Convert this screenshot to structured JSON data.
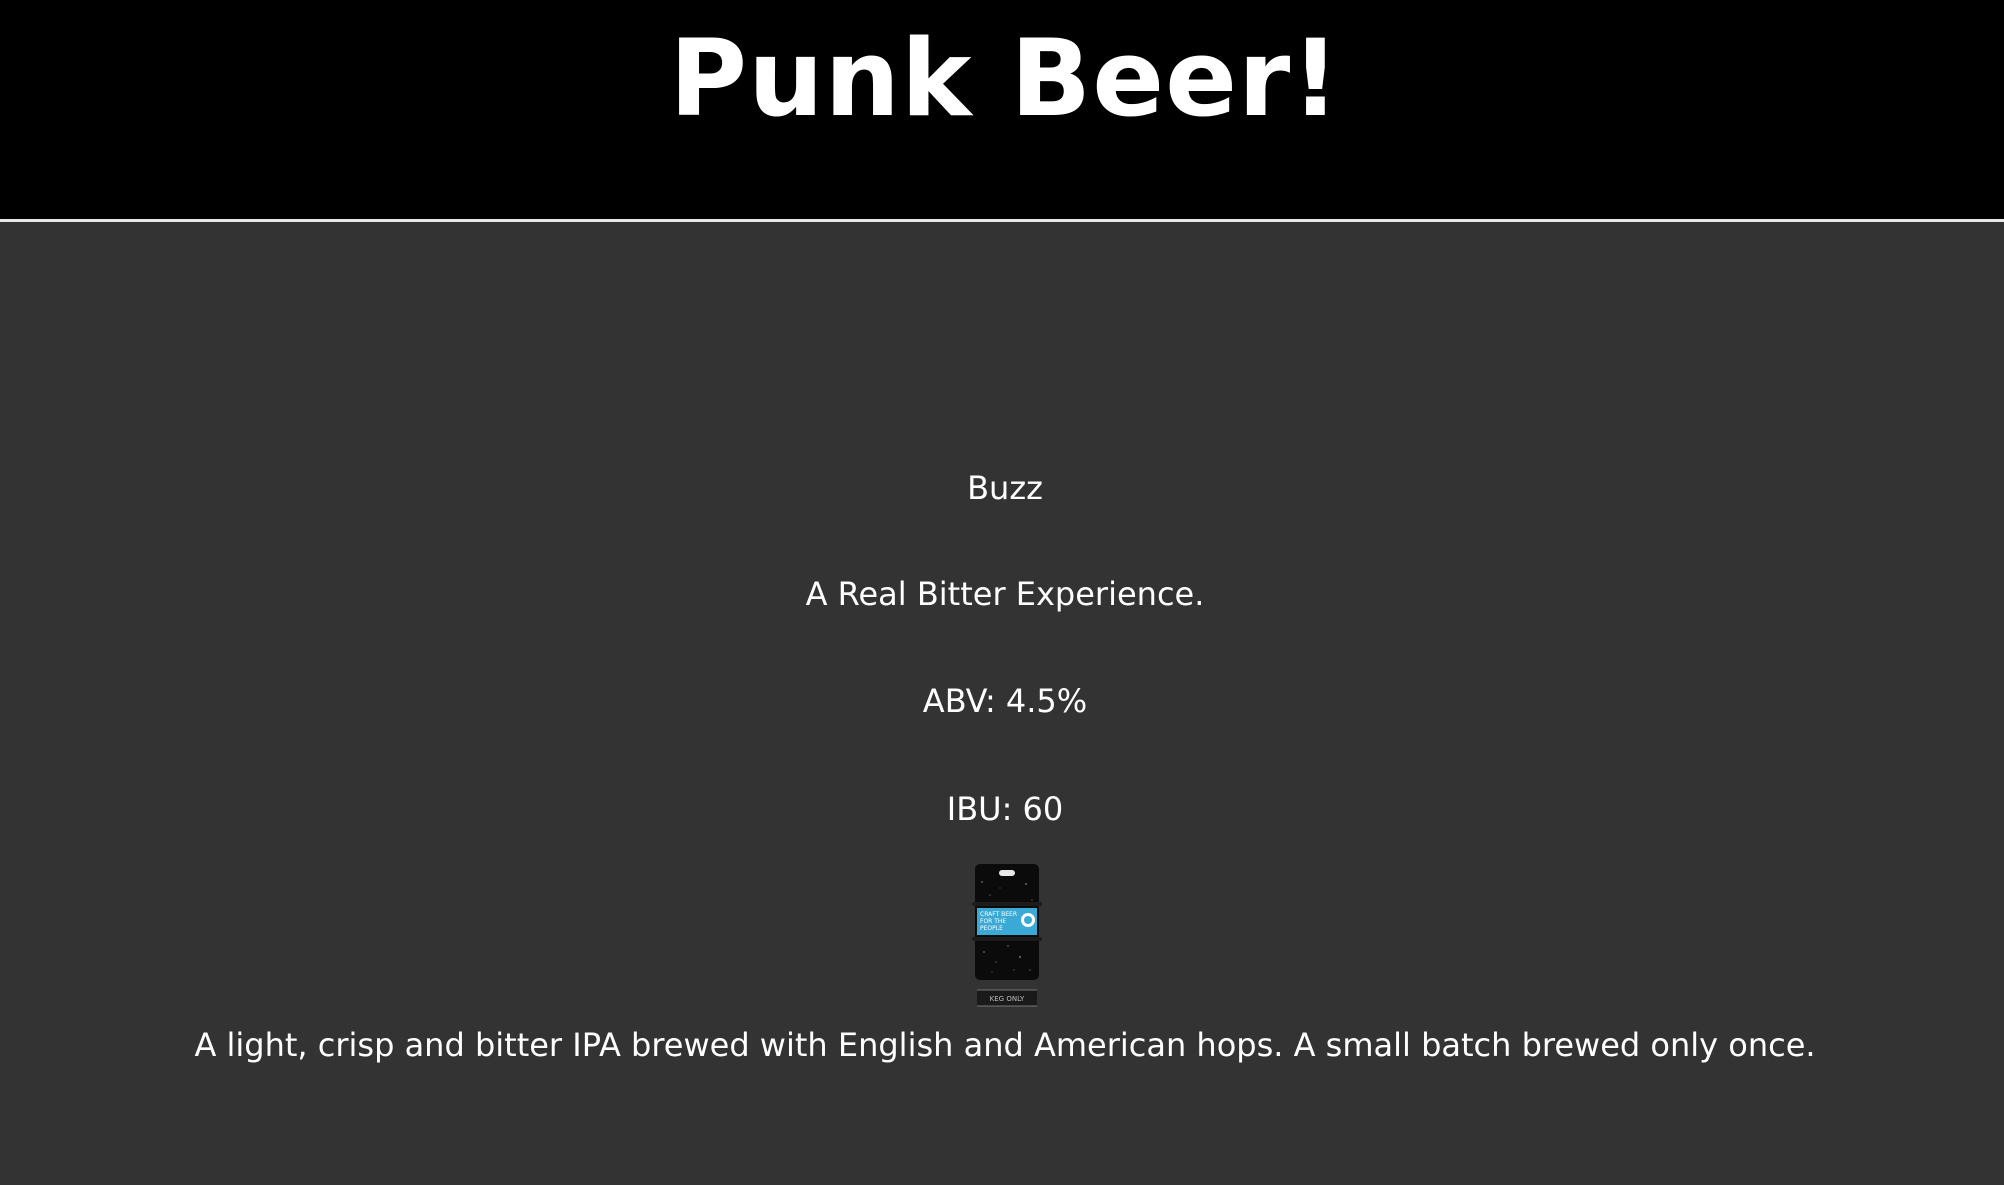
{
  "header": {
    "title": "Punk Beer!"
  },
  "beer": {
    "name": "Buzz",
    "tagline": "A Real Bitter Experience.",
    "abv": "ABV: 4.5%",
    "ibu": "IBU: 60",
    "description": "A light, crisp and bitter IPA brewed with English and American hops. A small batch brewed only once.",
    "image": {
      "label_lines": [
        "CRAFT BEER",
        "FOR THE",
        "PEOPLE"
      ],
      "footer_text": "KEG ONLY"
    }
  },
  "colors": {
    "header_bg": "#000000",
    "page_bg": "#333333",
    "text": "#ffffff",
    "keg_label": "#3aa9d6"
  }
}
